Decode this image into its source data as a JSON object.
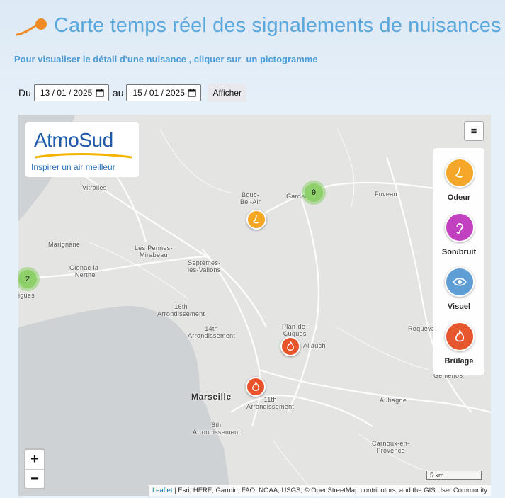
{
  "header": {
    "title": "Carte temps réel des signalements de nuisances",
    "subtitle": "Pour visualiser le détail d'une nuisance , cliquer sur  un pictogramme"
  },
  "filters": {
    "from_label": "Du",
    "from_value": "13 / 01 / 2025",
    "to_label": "au",
    "to_value": "15 / 01 / 2025",
    "submit_label": "Afficher"
  },
  "map": {
    "brand": {
      "name": "AtmoSud",
      "slogan": "Inspirer un air meilleur"
    },
    "places": {
      "vitrolles": "Vitrolles",
      "bouc_bel_air": "Bouc-\nBel-Air",
      "gardanne": "Gardanne",
      "fuveau": "Fuveau",
      "marignane": "Marignane",
      "les_pennes": "Les Pennes-\nMirabeau",
      "gignac": "Gignac-la-\nNerthe",
      "septemes": "Septèmes-\nles-Vallons",
      "martigues": "igues",
      "arr16": "16th\nArrondissement",
      "arr14": "14th\nArrondissement",
      "plan_de_cuques": "Plan-de-\nCuques",
      "allauch": "Allauch",
      "roquevaire": "Roquevaire",
      "marseille": "Marseille",
      "arr11": "11th\nArrondissement",
      "arr8": "8th\nArrondissement",
      "aubagne": "Aubagne",
      "gemenos": "Gémenos",
      "carnoux": "Carnoux-en-\nProvence"
    },
    "clusters": {
      "gardanne_count": "9",
      "west_count": "2"
    },
    "markers": [
      {
        "type": "odeur",
        "icon": "nose-icon"
      },
      {
        "type": "brulage",
        "icon": "flame-icon"
      },
      {
        "type": "brulage",
        "icon": "flame-icon"
      }
    ],
    "legend": [
      {
        "label": "Odeur",
        "icon": "nose-icon",
        "color": "#f5a623"
      },
      {
        "label": "Son/bruit",
        "icon": "ear-icon",
        "color": "#c13cbf"
      },
      {
        "label": "Visuel",
        "icon": "eye-icon",
        "color": "#5b9bd5"
      },
      {
        "label": "Brûlage",
        "icon": "flame-icon",
        "color": "#e8532a"
      }
    ],
    "zoom_in": "+",
    "zoom_out": "−",
    "layers_label": "≡",
    "scale_label": "5 km",
    "attribution_link": "Leaflet",
    "attribution_text": " | Esri, HERE, Garmin, FAO, NOAA, USGS, © OpenStreetMap contributors, and the GIS User Community"
  },
  "colors": {
    "accent": "#5aa7dc",
    "odeur": "#f5a623",
    "son": "#c13cbf",
    "visuel": "#5b9bd5",
    "brulage": "#e8532a",
    "cluster": "#8ed06a"
  }
}
